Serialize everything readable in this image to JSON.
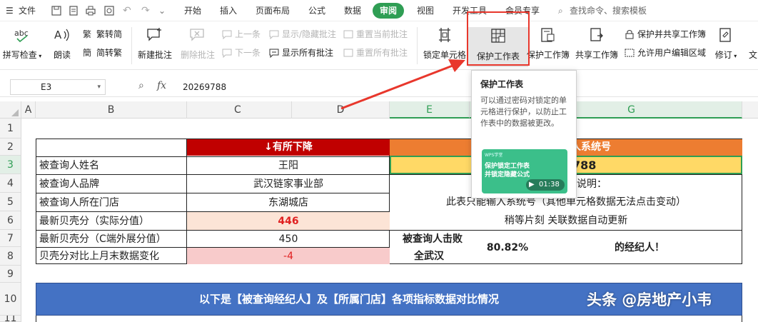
{
  "menubar": {
    "file_label": "文件",
    "tabs": [
      {
        "label": "开始"
      },
      {
        "label": "插入"
      },
      {
        "label": "页面布局"
      },
      {
        "label": "公式"
      },
      {
        "label": "数据"
      },
      {
        "label": "审阅"
      },
      {
        "label": "视图"
      },
      {
        "label": "开发工具"
      },
      {
        "label": "会员专享"
      }
    ],
    "active_tab": "审阅",
    "search_label": "查找命令、搜索模板"
  },
  "ribbon": {
    "spell_check": "拼写检查",
    "read_aloud": "朗读",
    "trad_simp": "繁转简",
    "simp_trad": "简转繁",
    "new_comment": "新建批注",
    "delete_comment": "删除批注",
    "prev_comment": "上一条",
    "next_comment": "下一条",
    "show_hide_comment": "显示/隐藏批注",
    "show_all_comments": "显示所有批注",
    "reset_current_comment": "重置当前批注",
    "reset_all_comments": "重置所有批注",
    "lock_cell": "锁定单元格",
    "protect_sheet": "保护工作表",
    "protect_workbook": "保护工作簿",
    "share_workbook": "共享工作簿",
    "protect_share_workbook": "保护并共享工作簿",
    "allow_user_edit": "允许用户编辑区域",
    "revise": "修订",
    "text_partial": "文"
  },
  "formula_bar": {
    "cell_ref": "E3",
    "fx": "fx",
    "formula": "20269788"
  },
  "columns": [
    "A",
    "B",
    "C",
    "D",
    "E",
    "F",
    "G"
  ],
  "rows": [
    "1",
    "2",
    "3",
    "4",
    "5",
    "6",
    "7",
    "8",
    "9",
    "10",
    "11"
  ],
  "table": {
    "header_trend": "↓有所下降",
    "header_system_no": "人系统号",
    "rows": [
      {
        "label": "被查询人姓名",
        "value": "王阳"
      },
      {
        "label": "被查询人品牌",
        "value": "武汉链家事业部"
      },
      {
        "label": "被查询人所在门店",
        "value": "东湖城店"
      },
      {
        "label": "最新贝壳分（实际分值）",
        "value": "446"
      },
      {
        "label": "最新贝壳分（C端外展分值）",
        "value": "450"
      },
      {
        "label": "贝壳分对比上月末数据变化",
        "value": "-4"
      }
    ],
    "system_no_partial": "788",
    "note_label_partial": "说明：",
    "note_line1": "此表只能输入系统号（其他单元格数据无法点击变动）",
    "note_line1_partial": "此表只能输入系统号（其他单元格数据无法点击变动）",
    "note_line2": "稍等片刻 关联数据自动更新",
    "beat_label": "被查询人击败",
    "beat_scope": "全武汉",
    "beat_pct": "80.82%",
    "beat_suffix": "的经纪人！"
  },
  "banner": {
    "text": "以下是【被查询经纪人】及【所属门店】各项指标数据对比情况",
    "watermark": "头条 @房地产小韦"
  },
  "tooltip": {
    "title": "保护工作表",
    "body": "可以通过密码对锁定的单元格进行保护，以防止工作表中的数据被更改。",
    "video_tag": "WPS学堂",
    "video_title_line1": "保护锁定工作表",
    "video_title_line2": "并锁定隐藏公式",
    "video_duration": "01:38"
  },
  "colors": {
    "accent": "#2f9e54",
    "red_header": "#c00000",
    "orange_header": "#ed7d31",
    "yellow_cell": "#ffd966",
    "pink_cell": "#fce4d6",
    "rose_cell": "#f8cbcb",
    "banner_blue": "#4472c4",
    "annotation_red": "#e8372c"
  }
}
